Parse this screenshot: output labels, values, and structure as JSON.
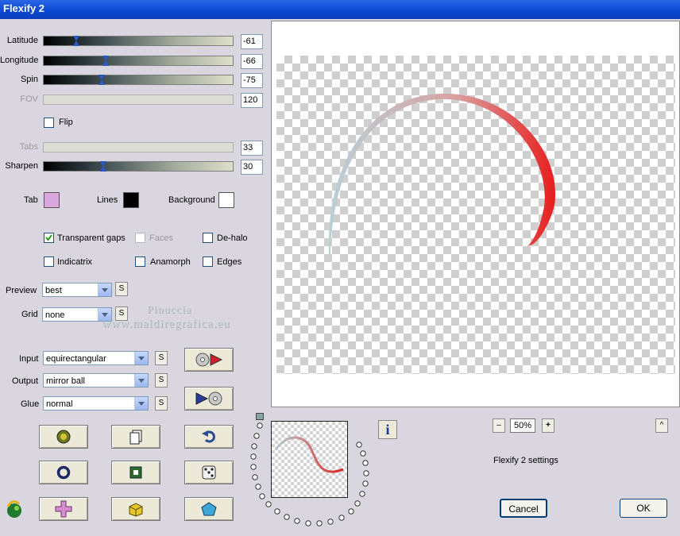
{
  "window": {
    "title": "Flexify 2"
  },
  "sliders": [
    {
      "label": "Latitude",
      "value": "-61",
      "enabled": true,
      "level": 0.15
    },
    {
      "label": "Longitude",
      "value": "-66",
      "enabled": true,
      "level": 0.27
    },
    {
      "label": "Spin",
      "value": "-75",
      "enabled": true,
      "level": 0.25
    },
    {
      "label": "FOV",
      "value": "120",
      "enabled": false
    },
    {
      "label": "Tabs",
      "value": "33",
      "enabled": false
    },
    {
      "label": "Sharpen",
      "value": "30",
      "enabled": true,
      "level": 0.26
    }
  ],
  "flip": {
    "label": "Flip",
    "checked": false
  },
  "colors": {
    "tab_label": "Tab",
    "tab_color": "#d8a8dc",
    "lines_label": "Lines",
    "lines_color": "#000000",
    "background_label": "Background",
    "background_color": "#ffffff"
  },
  "options": {
    "transparent_gaps": {
      "label": "Transparent gaps",
      "checked": true
    },
    "faces": {
      "label": "Faces",
      "checked": false,
      "enabled": false
    },
    "de_halo": {
      "label": "De-halo",
      "checked": false
    },
    "indicatrix": {
      "label": "Indicatrix",
      "checked": false
    },
    "anamorph": {
      "label": "Anamorph",
      "checked": false
    },
    "edges": {
      "label": "Edges",
      "checked": false
    }
  },
  "preview": {
    "label": "Preview",
    "value": "best"
  },
  "grid": {
    "label": "Grid",
    "value": "none"
  },
  "projection": {
    "input_label": "Input",
    "input_value": "equirectangular",
    "output_label": "Output",
    "output_value": "mirror ball",
    "glue_label": "Glue",
    "glue_value": "normal"
  },
  "s_button": "S",
  "watermark": {
    "line1": "Pinuccia",
    "line2": "www.maldiregrafica.eu"
  },
  "zoom": {
    "minus": "–",
    "value": "50%",
    "plus": "+"
  },
  "info_button": "i",
  "scroll_up": "^",
  "settings_text": "Flexify 2 settings",
  "buttons": {
    "cancel": "Cancel",
    "ok": "OK"
  },
  "accent": {
    "arc_start": "#b8d0d8",
    "arc_end": "#e81e1e"
  }
}
